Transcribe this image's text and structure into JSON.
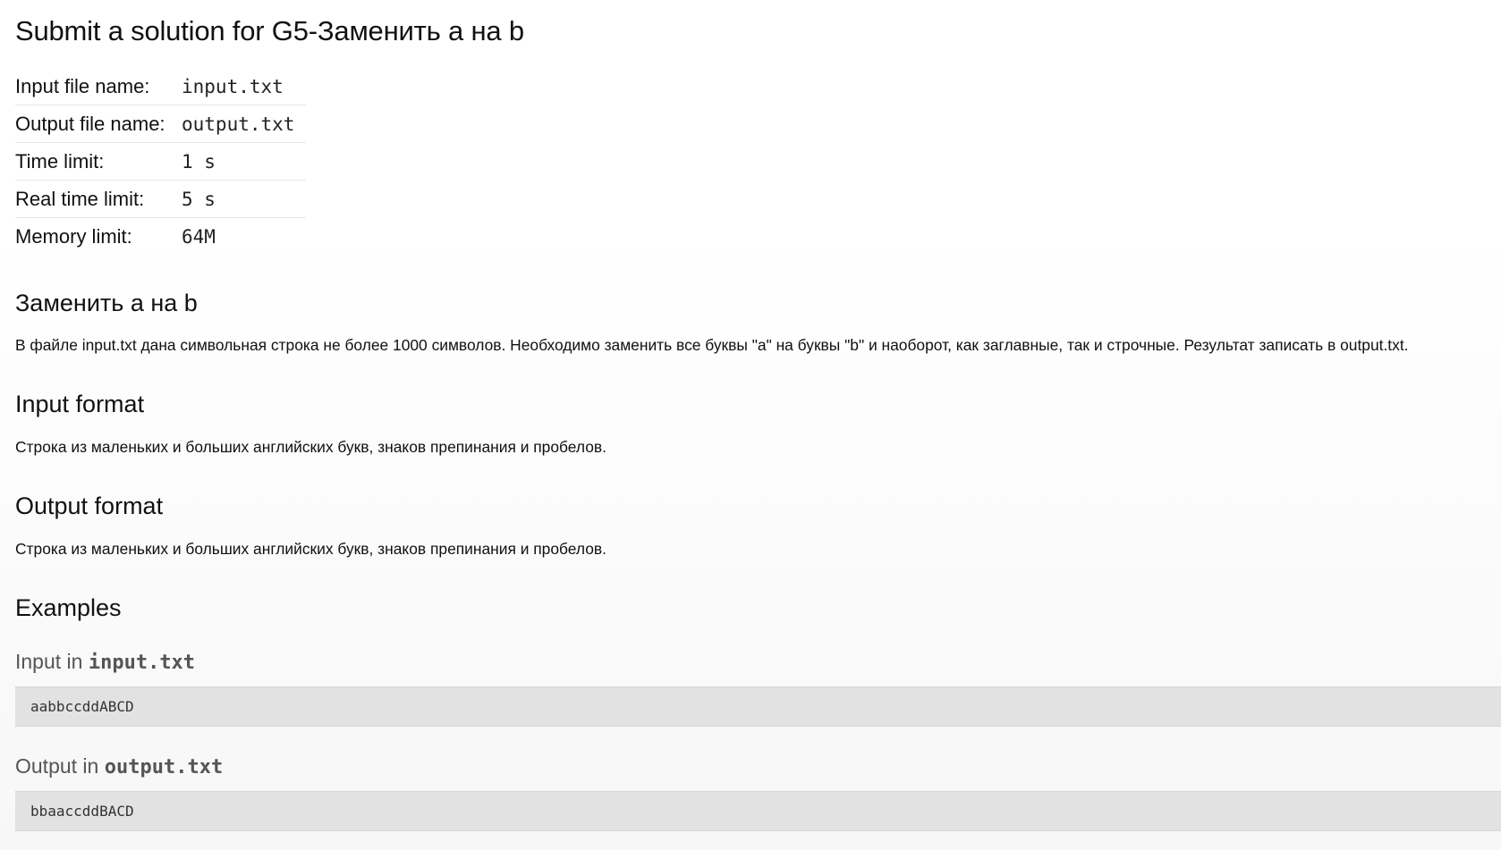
{
  "page": {
    "title": "Submit a solution for G5-Заменить а на b"
  },
  "limits": [
    {
      "label": "Input file name:",
      "value": "input.txt"
    },
    {
      "label": "Output file name:",
      "value": "output.txt"
    },
    {
      "label": "Time limit:",
      "value": "1 s"
    },
    {
      "label": "Real time limit:",
      "value": "5 s"
    },
    {
      "label": "Memory limit:",
      "value": "64M"
    }
  ],
  "statement": {
    "title": "Заменить а на b",
    "text": "В файле input.txt дана символьная строка не более 1000 символов. Необходимо заменить все буквы \"a\" на буквы \"b\" и наоборот, как заглавные, так и строчные. Результат записать в output.txt."
  },
  "input_format": {
    "title": "Input format",
    "text": "Строка из маленьких и больших английских букв, знаков препинания и пробелов."
  },
  "output_format": {
    "title": "Output format",
    "text": "Строка из маленьких и больших английских букв, знаков препинания и пробелов."
  },
  "examples": {
    "title": "Examples",
    "input_prefix": "Input in ",
    "input_file": "input.txt",
    "input_sample": "aabbccddABCD",
    "output_prefix": "Output in ",
    "output_file": "output.txt",
    "output_sample": "bbaaccddBACD"
  }
}
